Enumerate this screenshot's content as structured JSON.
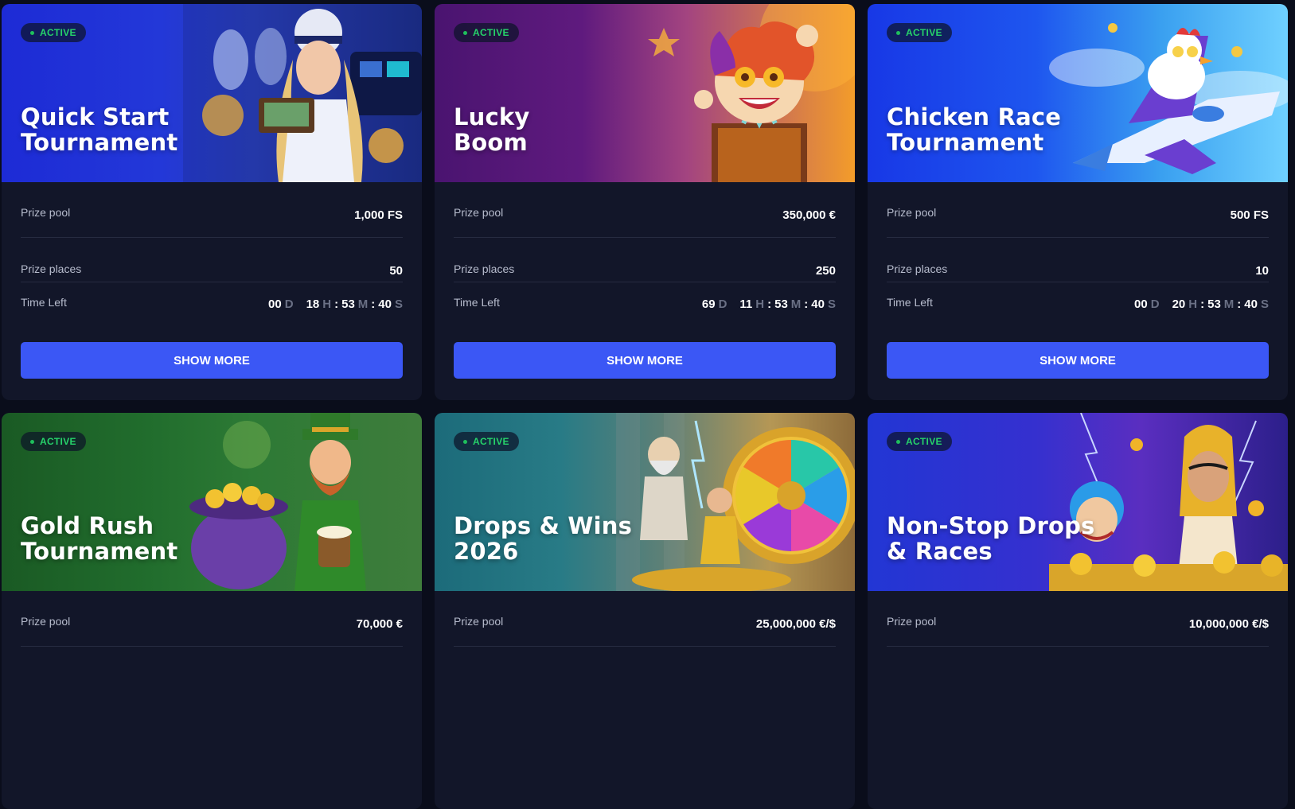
{
  "colors": {
    "page_bg": "#0a0d1b",
    "card_bg": "#121629",
    "button_bg": "#3b57f5",
    "active_badge": "#26d36a"
  },
  "labels": {
    "prize_pool": "Prize pool",
    "prize_places": "Prize places",
    "time_left": "Time Left",
    "show_more": "SHOW MORE",
    "active": "ACTIVE",
    "unit_d": "D",
    "unit_h": "H",
    "unit_m": "M",
    "unit_s": "S",
    "sep": ":"
  },
  "tournaments": [
    {
      "title_line1": "Quick Start",
      "title_line2": "Tournament",
      "status": "ACTIVE",
      "prize_pool": "1,000 FS",
      "prize_places": "50",
      "time_left": {
        "d": "00",
        "h": "18",
        "m": "53",
        "s": "40"
      },
      "art": "pilot-woman-cockpit"
    },
    {
      "title_line1": "Lucky",
      "title_line2": "Boom",
      "status": "ACTIVE",
      "prize_pool": "350,000 €",
      "prize_places": "250",
      "time_left": {
        "d": "69",
        "h": "11",
        "m": "53",
        "s": "40"
      },
      "art": "jester-in-a-box"
    },
    {
      "title_line1": "Chicken Race",
      "title_line2": "Tournament",
      "status": "ACTIVE",
      "prize_pool": "500 FS",
      "prize_places": "10",
      "time_left": {
        "d": "00",
        "h": "20",
        "m": "53",
        "s": "40"
      },
      "art": "chicken-on-jet"
    },
    {
      "title_line1": "Gold Rush",
      "title_line2": "Tournament",
      "status": "ACTIVE",
      "prize_pool": "70,000 €",
      "art": "leprechaun-pot-of-gold"
    },
    {
      "title_line1": "Drops & Wins",
      "title_line2": "2026",
      "status": "ACTIVE",
      "prize_pool": "25,000,000 €/$",
      "art": "zeus-and-prize-wheel"
    },
    {
      "title_line1": "Non-Stop Drops",
      "title_line2": "& Races",
      "status": "ACTIVE",
      "prize_pool": "10,000,000 €/$",
      "art": "cleopatra-and-jester-coins"
    }
  ]
}
